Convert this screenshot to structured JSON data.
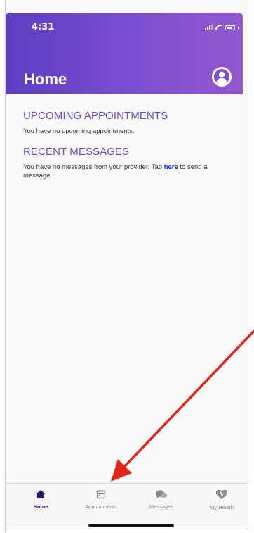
{
  "status_bar": {
    "time": "4:31"
  },
  "header": {
    "title": "Home"
  },
  "sections": {
    "upcoming": {
      "title": "UPCOMING APPOINTMENTS",
      "text": "You have no upcoming appointments."
    },
    "messages": {
      "title": "RECENT MESSAGES",
      "text_before": "You have no messages from your provider. Tap ",
      "link": "here",
      "text_after": " to send a message."
    }
  },
  "tabs": [
    {
      "label": "Home",
      "icon": "home-icon",
      "active": true
    },
    {
      "label": "Appointments",
      "icon": "calendar-icon",
      "active": false
    },
    {
      "label": "Messages",
      "icon": "chat-icon",
      "active": false
    },
    {
      "label": "My Health",
      "icon": "heart-pulse-icon",
      "active": false
    }
  ],
  "colors": {
    "header_gradient_start": "#5b3fc0",
    "header_gradient_end": "#9558cf",
    "section_title": "#6a47c4",
    "link": "#1a2cff",
    "active_tab": "#2d165e",
    "annotation_arrow": "#e1251b"
  }
}
